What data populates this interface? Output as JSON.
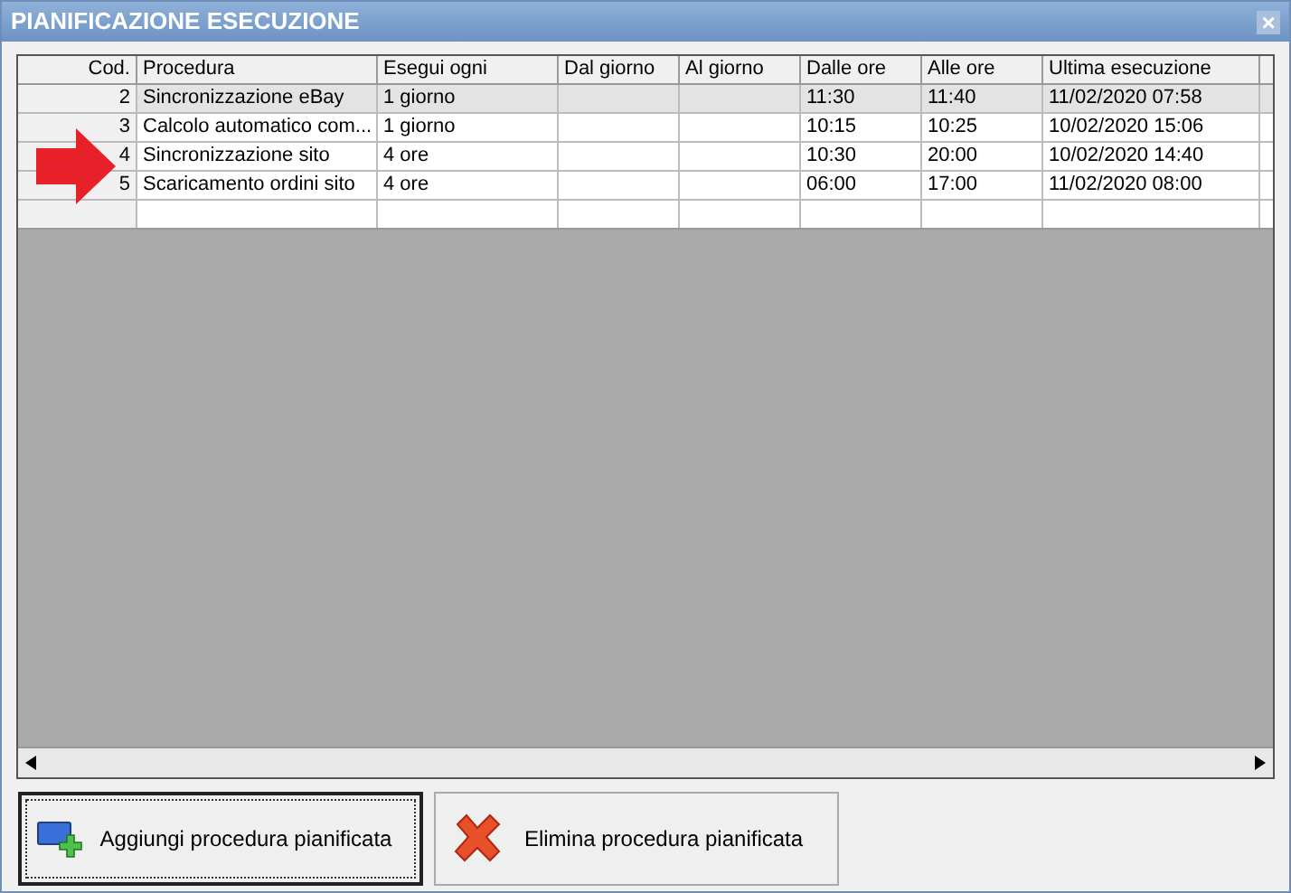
{
  "window": {
    "title": "PIANIFICAZIONE ESECUZIONE",
    "close": "×"
  },
  "table": {
    "columns": [
      "Cod.",
      "Procedura",
      "Esegui ogni",
      "Dal giorno",
      "Al giorno",
      "Dalle ore",
      "Alle ore",
      "Ultima esecuzione"
    ],
    "rows": [
      {
        "cells": [
          "2",
          "Sincronizzazione eBay",
          "1 giorno",
          "",
          "",
          "11:30",
          "11:40",
          "11/02/2020 07:58"
        ],
        "selected": true
      },
      {
        "cells": [
          "3",
          "Calcolo automatico com...",
          "1 giorno",
          "",
          "",
          "10:15",
          "10:25",
          "10/02/2020 15:06"
        ],
        "selected": false
      },
      {
        "cells": [
          "4",
          "Sincronizzazione sito",
          "4 ore",
          "",
          "",
          "10:30",
          "20:00",
          "10/02/2020 14:40"
        ],
        "selected": false
      },
      {
        "cells": [
          "5",
          "Scaricamento ordini sito",
          "4 ore",
          "",
          "",
          "06:00",
          "17:00",
          "11/02/2020 08:00"
        ],
        "selected": false
      }
    ]
  },
  "buttons": [
    {
      "label": "Aggiungi procedura pianificata",
      "kind": "add",
      "focused": true
    },
    {
      "label": "Elimina procedura pianificata",
      "kind": "delete",
      "focused": false
    }
  ]
}
